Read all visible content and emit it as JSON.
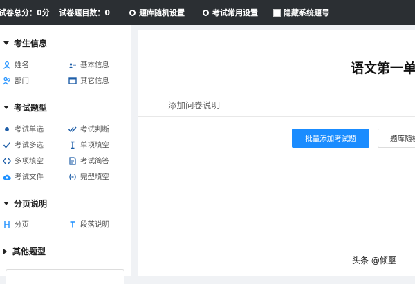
{
  "topbar": {
    "total_score": "试卷总分：0分",
    "separator": "|",
    "question_count": "试卷题目数：0",
    "random_btn": "题库随机设置",
    "common_btn": "考试常用设置",
    "hide_numbers": "隐藏系统题号"
  },
  "sidebar": {
    "candidate_info": {
      "title": "考生信息",
      "items": [
        "姓名",
        "基本信息",
        "部门",
        "其它信息"
      ]
    },
    "exam_types": {
      "title": "考试题型",
      "items": [
        "考试单选",
        "考试判断",
        "考试多选",
        "单项填空",
        "多项填空",
        "考试简答",
        "考试文件",
        "完型填空"
      ]
    },
    "pagination": {
      "title": "分页说明",
      "items": [
        "分页",
        "段落说明"
      ]
    },
    "other_types": {
      "title": "其他题型"
    }
  },
  "main": {
    "title": "语文第一单",
    "add_desc": "添加问卷说明",
    "batch_add": "批量添加考试题",
    "bank_random": "题库随机"
  },
  "watermark": "头条 @倾璽"
}
